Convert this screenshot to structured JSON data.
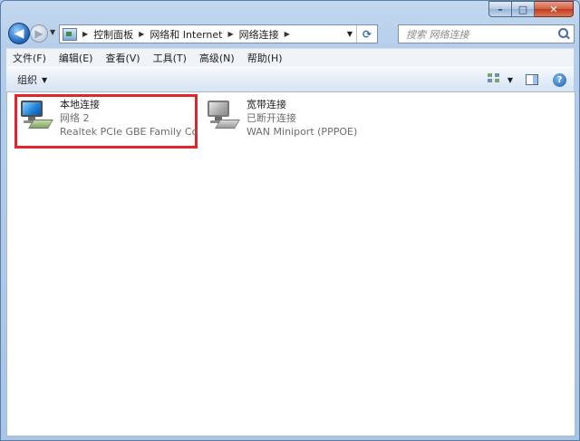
{
  "window": {
    "caption_buttons": {
      "minimize": "–",
      "maximize": "□",
      "close": "✕"
    }
  },
  "nav": {
    "back_glyph": "◀",
    "forward_glyph": "▶",
    "breadcrumb": [
      "控制面板",
      "网络和 Internet",
      "网络连接"
    ],
    "search_placeholder": "搜索 网络连接"
  },
  "menu": {
    "items": [
      "文件(F)",
      "编辑(E)",
      "查看(V)",
      "工具(T)",
      "高级(N)",
      "帮助(H)"
    ]
  },
  "commandbar": {
    "organize_label": "组织",
    "help_glyph": "?"
  },
  "connections": [
    {
      "name": "本地连接",
      "status": "网络  2",
      "device": "Realtek PCIe GBE Family Contr...",
      "icon": "network-adapter-icon",
      "highlighted": true
    },
    {
      "name": "宽带连接",
      "status": "已断开连接",
      "device": "WAN Miniport (PPPOE)",
      "icon": "network-adapter-disconnected-icon",
      "highlighted": false
    }
  ],
  "colors": {
    "highlight_border": "#e4232c",
    "frame": "#b4cde9"
  }
}
